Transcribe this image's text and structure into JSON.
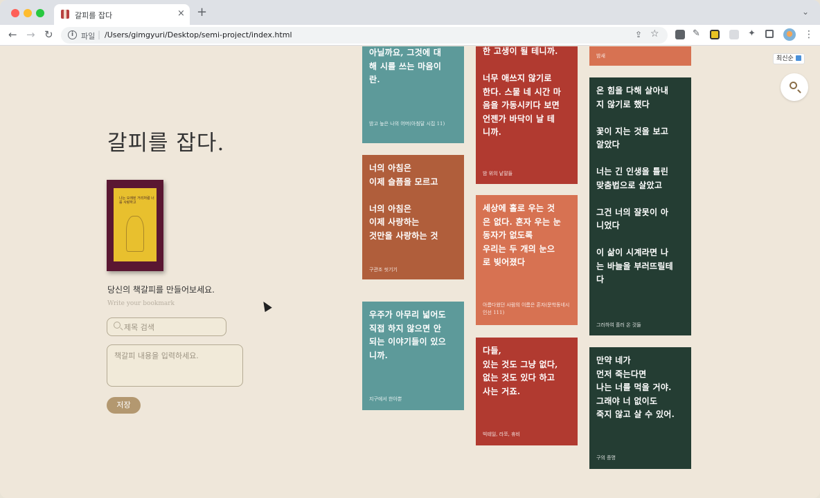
{
  "browser": {
    "tab_title": "갈피를 잡다",
    "tab_close": "×",
    "new_tab": "+",
    "url_scheme": "파일",
    "url_separator": "|",
    "url": "/Users/gimgyuri/Desktop/semi-project/index.html"
  },
  "sidebar": {
    "title": "갈피를 잡다.",
    "book_cover_text": "나는 오래된 거리처럼 너를 사랑하고",
    "prompt": "당신의 책갈피를 만들어보세요.",
    "prompt_sub": "Write your bookmark",
    "search_placeholder": "제목 검색",
    "content_placeholder": "책갈피 내용을 입력하세요.",
    "save_label": "저장"
  },
  "sort_label": "최신순",
  "cards": [
    {
      "text": "아닐까요, 그것에 대\n해 시를 쓰는 마음이\n란.",
      "source": "밤고 높은 나의 어머(아침달 시집 11)",
      "color": "#5d9a9a"
    },
    {
      "text": "너의 아침은\n이제 슬픔을 모르고\n\n너의 아침은\n이제 사랑하는\n것만을 사랑하는 것",
      "source": "구관조 씻기기",
      "color": "#b05e3b"
    },
    {
      "text": "우주가 아무리 넓어도\n직접 하지 않으면 안\n되는 이야기들이 있으\n니까.",
      "source": "지구에서 한아뿐",
      "color": "#5d9a9a"
    },
    {
      "text": "한 고생이 될 테니까.\n\n너무 애쓰지 않기로\n한다. 스물 네 시간 마\n음을 가동시키다 보면\n언젠가 바닥이 날 테\n니까.",
      "source": "밤 위의 낱말들",
      "color": "#b13a30"
    },
    {
      "text": "세상에 홀로 우는 것\n은 없다. 혼자 우는 눈\n동자가 없도록\n우리는 두 개의 눈으\n로 빚어졌다",
      "source": "아름다웠던 사람의 이름은 혼자(문학동네시인선 111)",
      "color": "#d77252"
    },
    {
      "text": "다들,\n있는 것도 그냥 없다,\n없는 것도 있다 하고\n사는 거죠.",
      "source": "빅테일, 라쪼, 휴비",
      "color": "#b13a30"
    },
    {
      "text": "",
      "source": "밤새",
      "color": "#d77252"
    },
    {
      "text": "온 힘을 다해 살아내\n지 않기로 했다\n\n꽃이 지는 것을 보고\n알았다\n\n너는 긴 인생을 틀린\n맞춤법으로 살았고\n\n그건 너의 잘못이 아\n니었다\n\n이 삶이 시계라면 나\n는 바늘을 부러뜨릴테\n다",
      "source": "그러하여 흘러 온 것들",
      "color": "#243d33"
    },
    {
      "text": "만약 네가\n먼저 죽는다면\n나는 너를 먹을 거야.\n그래야 너 없이도\n죽지 않고 살 수 있어.",
      "source": "구의 증명",
      "color": "#243d33"
    }
  ]
}
